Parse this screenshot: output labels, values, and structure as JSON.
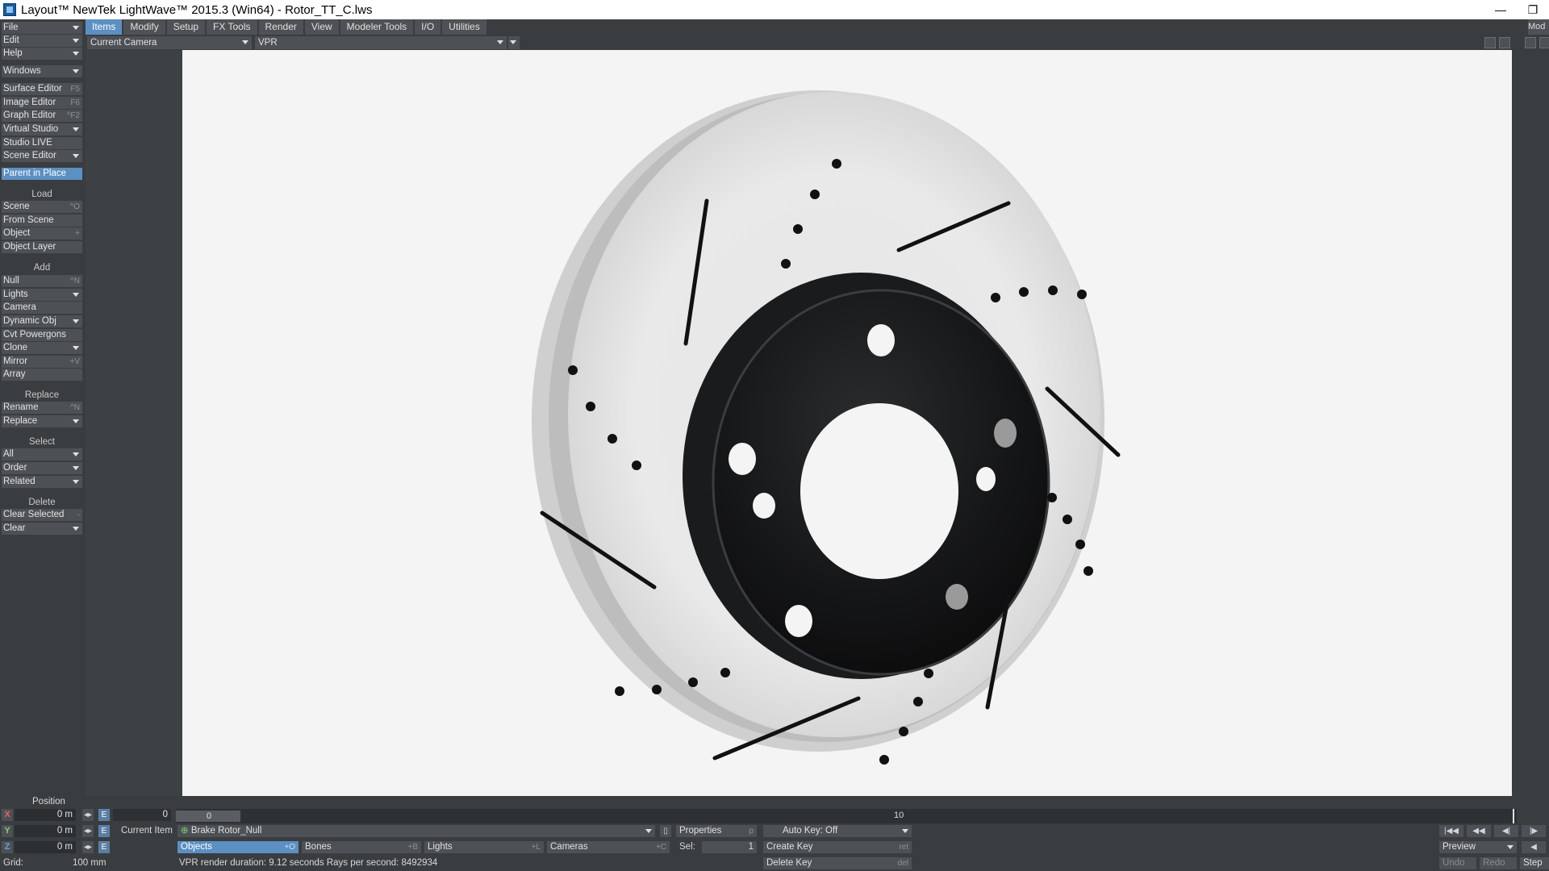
{
  "window": {
    "title": "Layout™ NewTek LightWave™ 2015.3 (Win64) - Rotor_TT_C.lws",
    "minimize_glyph": "—",
    "restore_glyph": "❐"
  },
  "menu_tabs": [
    {
      "label": "Items",
      "active": true
    },
    {
      "label": "Modify"
    },
    {
      "label": "Setup"
    },
    {
      "label": "FX Tools"
    },
    {
      "label": "Render"
    },
    {
      "label": "View"
    },
    {
      "label": "Modeler Tools"
    },
    {
      "label": "I/O"
    },
    {
      "label": "Utilities"
    }
  ],
  "mod_button": "Mod",
  "sidebar": {
    "top_menus": [
      "File",
      "Edit",
      "Help"
    ],
    "windows": "Windows",
    "editors": [
      {
        "label": "Surface Editor",
        "hotkey": "F5"
      },
      {
        "label": "Image Editor",
        "hotkey": "F6"
      },
      {
        "label": "Graph Editor",
        "hotkey": "^F2"
      },
      {
        "label": "Virtual Studio"
      },
      {
        "label": "Studio LIVE"
      },
      {
        "label": "Scene Editor"
      }
    ],
    "parent_in_place": "Parent in Place",
    "load_header": "Load",
    "load_items": [
      {
        "label": "Scene",
        "hotkey": "^O"
      },
      {
        "label": "From Scene"
      },
      {
        "label": "Object",
        "hotkey": "+"
      },
      {
        "label": "Object Layer"
      }
    ],
    "add_header": "Add",
    "add_items": [
      {
        "label": "Null",
        "hotkey": "^N"
      },
      {
        "label": "Lights"
      },
      {
        "label": "Camera"
      },
      {
        "label": "Dynamic Obj"
      },
      {
        "label": "Cvt Powergons"
      },
      {
        "label": "Clone"
      },
      {
        "label": "Mirror",
        "hotkey": "+V"
      },
      {
        "label": "Array"
      }
    ],
    "replace_header": "Replace",
    "replace_items": [
      {
        "label": "Rename",
        "hotkey": "^N"
      },
      {
        "label": "Replace"
      }
    ],
    "select_header": "Select",
    "select_items": [
      {
        "label": "All"
      },
      {
        "label": "Order"
      },
      {
        "label": "Related"
      }
    ],
    "delete_header": "Delete",
    "delete_items": [
      {
        "label": "Clear Selected",
        "hotkey": "-"
      },
      {
        "label": "Clear"
      }
    ]
  },
  "viewbar": {
    "camera": "Current Camera",
    "render_mode": "VPR"
  },
  "bottom": {
    "position_label": "Position",
    "x_label": "X",
    "y_label": "Y",
    "z_label": "Z",
    "x_value": "0 m",
    "y_value": "0 m",
    "z_value": "0 m",
    "e_label": "E",
    "grid_label": "Grid:",
    "grid_value": "100 mm",
    "frame_field": "0",
    "timeline_current": "0",
    "timeline_tick": "10",
    "current_item_label": "Current Item",
    "current_item": "Brake Rotor_Null",
    "objects": "Objects",
    "objects_hotkey": "+O",
    "bones": "Bones",
    "bones_hotkey": "+B",
    "lights": "Lights",
    "lights_hotkey": "+L",
    "cameras": "Cameras",
    "cameras_hotkey": "+C",
    "properties": "Properties",
    "properties_hotkey": "p",
    "sel_label": "Sel:",
    "sel_value": "1",
    "auto_key": "Auto Key: Off",
    "create_key": "Create Key",
    "create_key_hotkey": "ret",
    "delete_key": "Delete Key",
    "delete_key_hotkey": "del",
    "status": "VPR render duration: 9.12 seconds  Rays per second: 8492934",
    "preview": "Preview",
    "undo": "Undo",
    "redo": "Redo",
    "step": "Step"
  }
}
